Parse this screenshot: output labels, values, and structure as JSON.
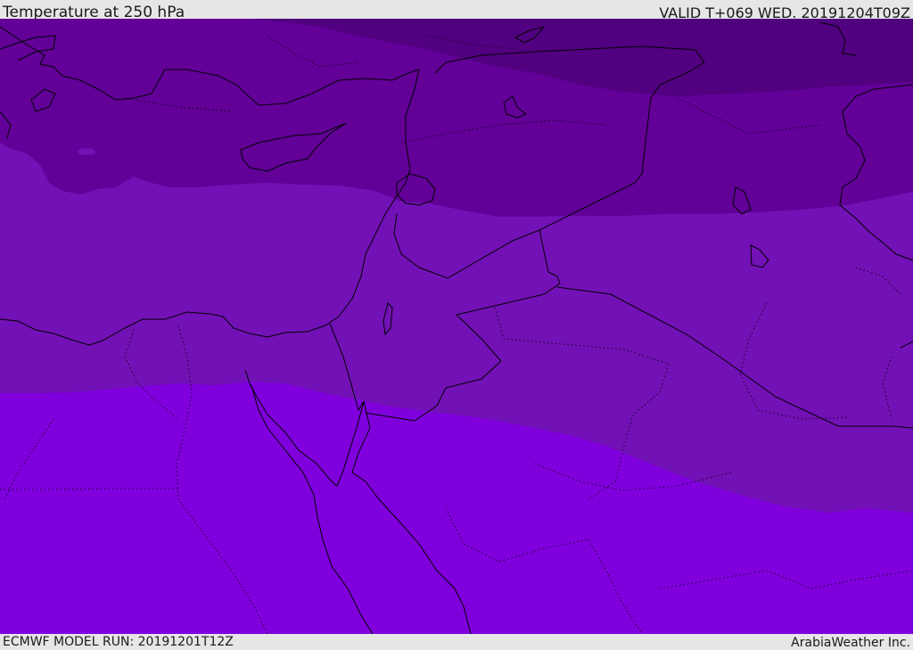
{
  "header": {
    "title": "Temperature at 250 hPa",
    "valid": "VALID T+069 WED. 20191204T09Z"
  },
  "footer": {
    "model_run": "ECMWF MODEL RUN: 20191201T12Z",
    "credit": "ArabiaWeather Inc."
  },
  "colors": {
    "band_darkest": "#510080",
    "band_dark": "#620098",
    "band_mid": "#7211b5",
    "band_light": "#7f00dd",
    "borders": "#000000",
    "background": "#e6e6e6"
  }
}
